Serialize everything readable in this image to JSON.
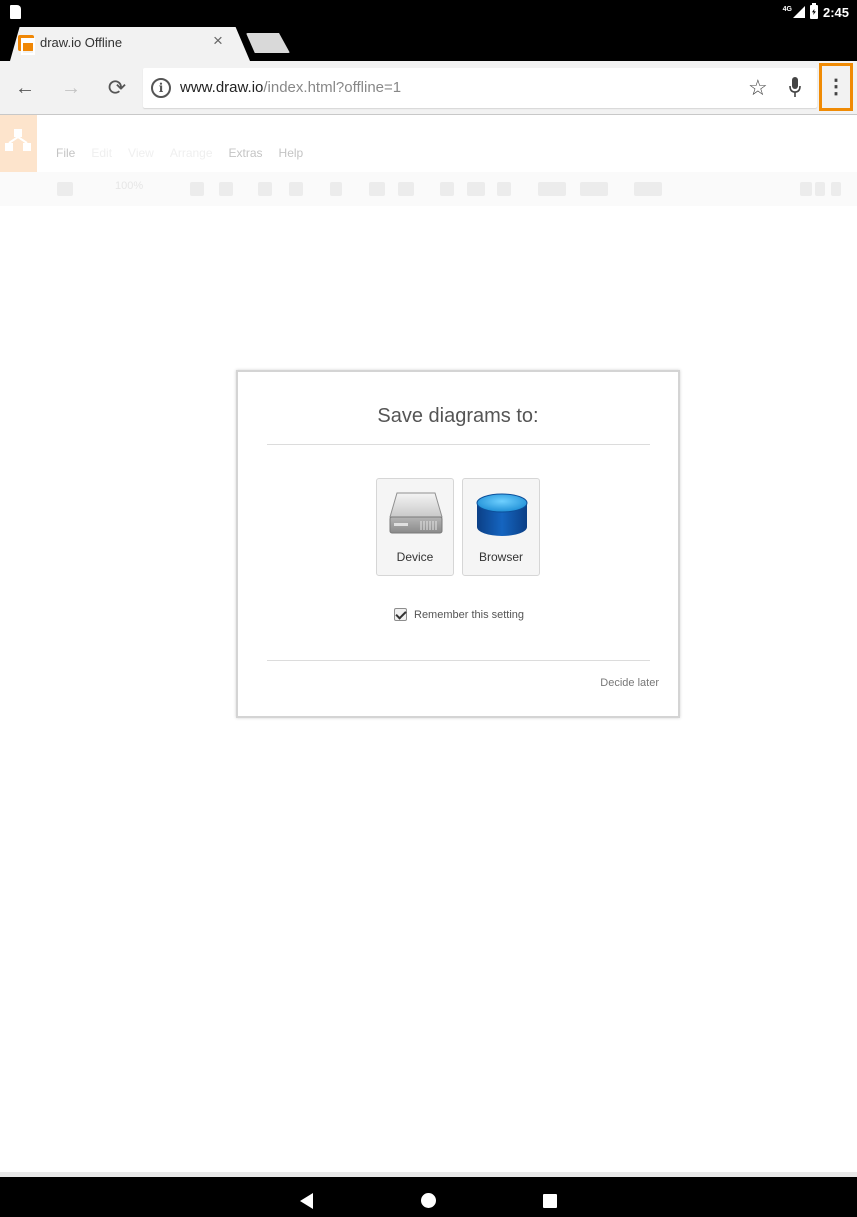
{
  "status_bar": {
    "network": "4G",
    "time": "2:45"
  },
  "browser": {
    "tab": {
      "title": "draw.io Offline",
      "close_glyph": "×"
    },
    "toolbar": {
      "back_glyph": "←",
      "forward_glyph": "→",
      "reload_glyph": "⟳",
      "url_host": "www.draw.io",
      "url_path": "/index.html?offline=1",
      "star_glyph": "☆",
      "menu_glyph": "⋮",
      "info_glyph": "i"
    }
  },
  "app": {
    "menus": [
      {
        "label": "File",
        "enabled": true
      },
      {
        "label": "Edit",
        "enabled": false
      },
      {
        "label": "View",
        "enabled": false
      },
      {
        "label": "Arrange",
        "enabled": false
      },
      {
        "label": "Extras",
        "enabled": true
      },
      {
        "label": "Help",
        "enabled": true
      }
    ],
    "zoom": "100%"
  },
  "dialog": {
    "title": "Save diagrams to:",
    "options": [
      {
        "label": "Device",
        "icon": "hard-drive-icon"
      },
      {
        "label": "Browser",
        "icon": "database-icon"
      }
    ],
    "remember_label": "Remember this setting",
    "remember_checked": true,
    "decide_later": "Decide later"
  },
  "colors": {
    "accent": "#f08705",
    "highlight_border": "#f08b05",
    "browser_db": "#1565c0"
  }
}
